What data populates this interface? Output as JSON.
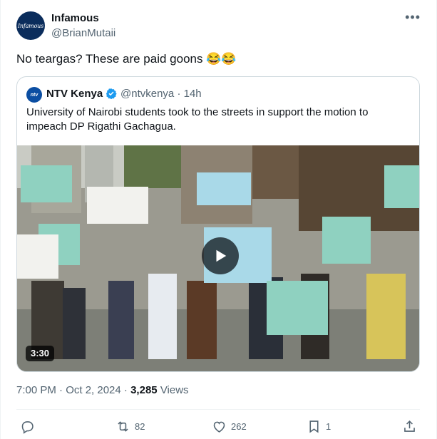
{
  "tweet": {
    "author_name": "Infamous",
    "author_handle": "@BrianMutaii",
    "avatar_text": "Infamous",
    "text": "No teargas? These are paid goons 😂😂",
    "timestamp": "7:00 PM · Oct 2, 2024",
    "views_count": "3,285",
    "views_label": "Views"
  },
  "quote": {
    "avatar_text": "ntv",
    "author_name": "NTV Kenya",
    "author_handle": "@ntvkenya",
    "time": "· 14h",
    "text": "University of Nairobi students took to the streets in support the motion to impeach DP Rigathi Gachagua.",
    "video_duration": "3:30"
  },
  "actions": {
    "reply_count": "",
    "retweet_count": "82",
    "like_count": "262",
    "bookmark_count": "1"
  },
  "icons": [
    "more-icon",
    "verified-icon",
    "play-icon",
    "reply-icon",
    "retweet-icon",
    "like-icon",
    "bookmark-icon",
    "share-icon"
  ],
  "colors": {
    "text": "#0f1419",
    "secondary": "#536471",
    "verified": "#1d9bf0",
    "border": "#cfd9de"
  }
}
